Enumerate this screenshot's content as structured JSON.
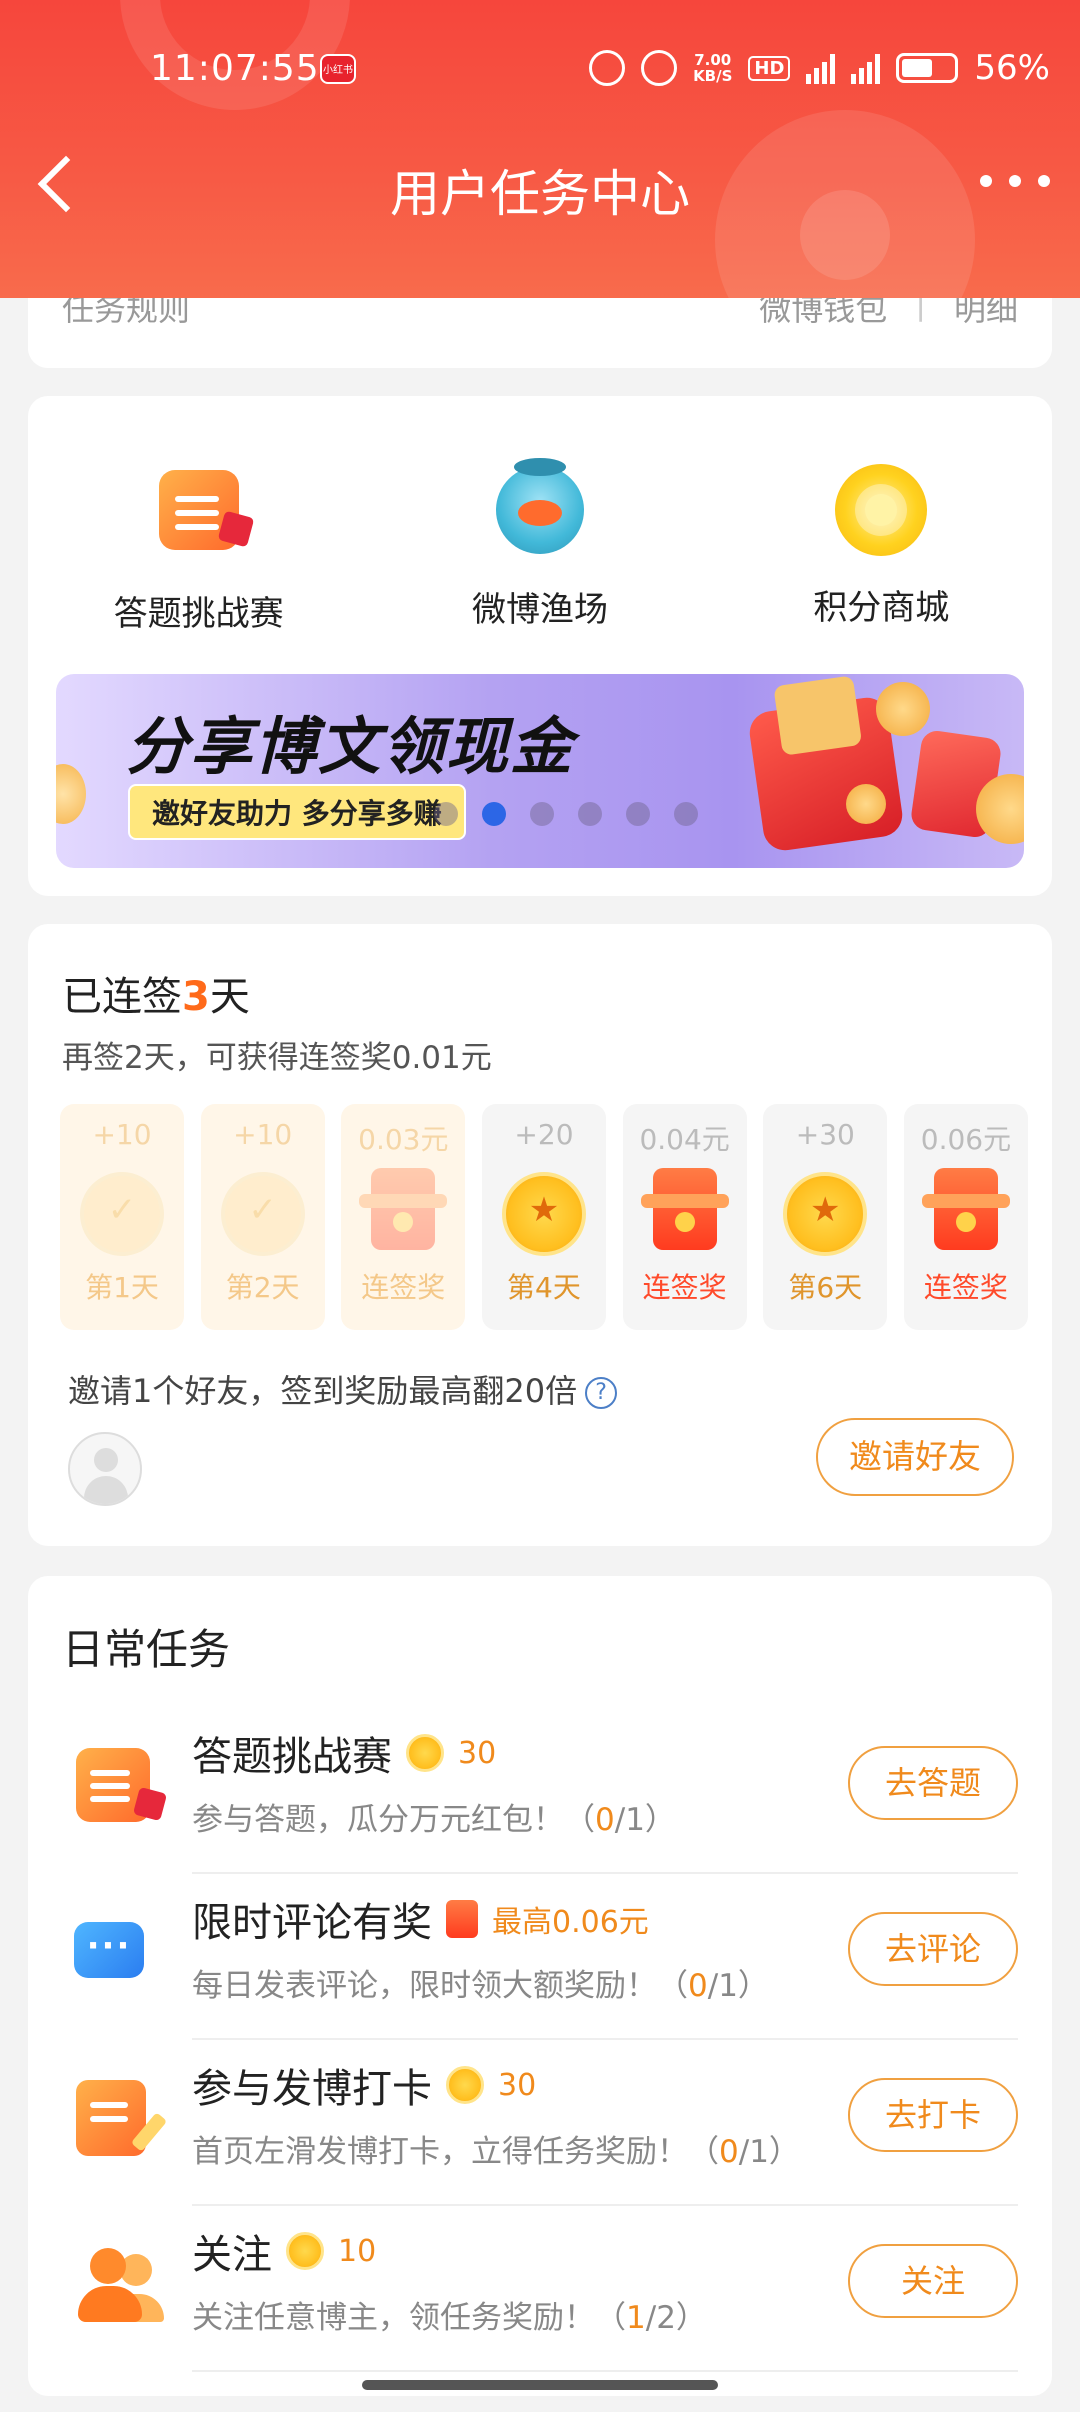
{
  "status_bar": {
    "time": "11:07:55",
    "app_badge": "小红书",
    "net_speed": "7.00",
    "net_speed_unit": "KB/S",
    "hd": "HD",
    "signal1": "4G",
    "signal2": "4G",
    "battery": "56%"
  },
  "header": {
    "title": "用户任务中心"
  },
  "rules_card": {
    "rules_link": "任务规则",
    "wallet_link": "微博钱包",
    "separator": "|",
    "detail_link": "明细"
  },
  "entries": [
    {
      "label": "答题挑战赛",
      "icon": "quiz-icon"
    },
    {
      "label": "微博渔场",
      "icon": "fish-icon"
    },
    {
      "label": "积分商城",
      "icon": "mall-icon"
    }
  ],
  "banner": {
    "title": "分享博文领现金",
    "subtitle": "邀好友助力 多分享多赚",
    "slide_count": 6,
    "active_slide": 1
  },
  "sign_in": {
    "title_prefix": "已连签",
    "days_count": "3",
    "title_suffix": "天",
    "subtitle": "再签2天，可获得连签奖0.01元",
    "days": [
      {
        "reward": "+10",
        "name": "第1天",
        "state": "done",
        "type": "coin"
      },
      {
        "reward": "+10",
        "name": "第2天",
        "state": "done",
        "type": "coin"
      },
      {
        "reward": "0.03元",
        "name": "连签奖",
        "state": "done",
        "type": "packet"
      },
      {
        "reward": "+20",
        "name": "第4天",
        "state": "future",
        "type": "coin"
      },
      {
        "reward": "0.04元",
        "name": "连签奖",
        "state": "future",
        "type": "packet"
      },
      {
        "reward": "+30",
        "name": "第6天",
        "state": "future",
        "type": "coin"
      },
      {
        "reward": "0.06元",
        "name": "连签奖",
        "state": "future",
        "type": "packet"
      }
    ],
    "invite_text": "邀请1个好友，签到奖励最高翻20倍",
    "help_icon": "?",
    "invite_button": "邀请好友"
  },
  "daily_tasks": {
    "title": "日常任务",
    "tasks": [
      {
        "name": "答题挑战赛",
        "reward_type": "coin",
        "reward": "30",
        "desc": "参与答题，瓜分万元红包！",
        "done": "0",
        "total": "1",
        "button": "去答题",
        "icon": "quiz-icon"
      },
      {
        "name": "限时评论有奖",
        "reward_type": "packet",
        "reward": "最高0.06元",
        "desc": "每日发表评论，限时领大额奖励！",
        "done": "0",
        "total": "1",
        "button": "去评论",
        "icon": "comment-icon"
      },
      {
        "name": "参与发博打卡",
        "reward_type": "coin",
        "reward": "30",
        "desc": "首页左滑发博打卡，立得任务奖励！",
        "done": "0",
        "total": "1",
        "button": "去打卡",
        "icon": "post-icon"
      },
      {
        "name": "关注",
        "reward_type": "coin",
        "reward": "10",
        "desc": "关注任意博主，领任务奖励！",
        "done": "1",
        "total": "2",
        "button": "关注",
        "icon": "follow-icon"
      }
    ]
  }
}
